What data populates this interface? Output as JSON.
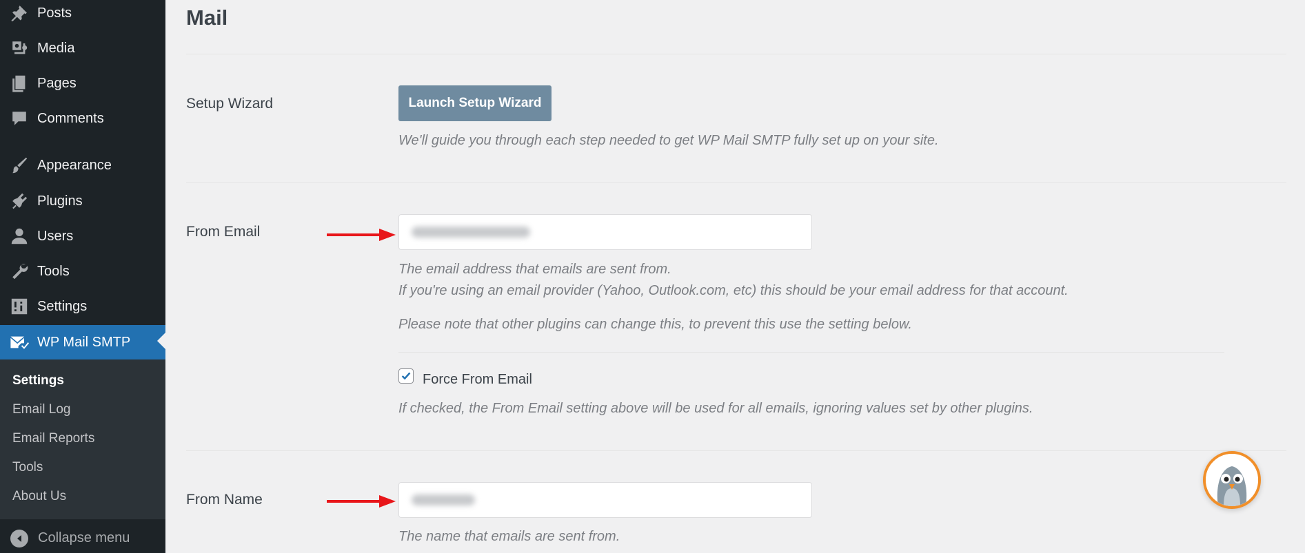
{
  "sidebar": {
    "items": [
      {
        "label": "Posts",
        "icon": "pin-icon"
      },
      {
        "label": "Media",
        "icon": "media-icon"
      },
      {
        "label": "Pages",
        "icon": "pages-icon"
      },
      {
        "label": "Comments",
        "icon": "comment-icon"
      },
      {
        "label": "Appearance",
        "icon": "brush-icon"
      },
      {
        "label": "Plugins",
        "icon": "plugin-icon"
      },
      {
        "label": "Users",
        "icon": "user-icon"
      },
      {
        "label": "Tools",
        "icon": "wrench-icon"
      },
      {
        "label": "Settings",
        "icon": "sliders-icon"
      },
      {
        "label": "WP Mail SMTP",
        "icon": "mail-check-icon",
        "active": true
      }
    ],
    "submenu": [
      "Settings",
      "Email Log",
      "Email Reports",
      "Tools",
      "About Us"
    ],
    "collapse_label": "Collapse menu"
  },
  "main": {
    "title": "Mail",
    "setup_wizard": {
      "label": "Setup Wizard",
      "button": "Launch Setup Wizard",
      "description": "We'll guide you through each step needed to get WP Mail SMTP fully set up on your site."
    },
    "from_email": {
      "label": "From Email",
      "value": "",
      "desc_1": "The email address that emails are sent from.",
      "desc_2": "If you're using an email provider (Yahoo, Outlook.com, etc) this should be your email address for that account.",
      "desc_3": "Please note that other plugins can change this, to prevent this use the setting below.",
      "force_label": "Force From Email",
      "force_checked": true,
      "force_desc": "If checked, the From Email setting above will be used for all emails, ignoring values set by other plugins."
    },
    "from_name": {
      "label": "From Name",
      "value": "",
      "desc": "The name that emails are sent from."
    }
  },
  "colors": {
    "sidebar_bg": "#1d2327",
    "active_blue": "#2271b1",
    "wizard_button": "#6f8ba0",
    "arrow_red": "#e8161a",
    "bird_ring": "#f18f29"
  }
}
